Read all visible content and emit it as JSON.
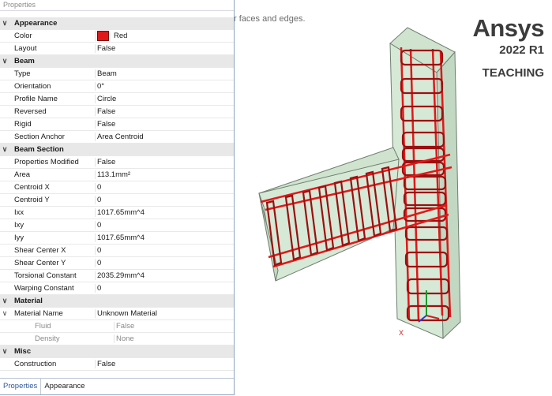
{
  "panel": {
    "title": "Properties",
    "groups": [
      {
        "name": "Appearance",
        "props": [
          {
            "name": "Color",
            "value": "Red"
          },
          {
            "name": "Layout",
            "value": "False"
          }
        ]
      },
      {
        "name": "Beam",
        "props": [
          {
            "name": "Type",
            "value": "Beam"
          },
          {
            "name": "Orientation",
            "value": "0°"
          },
          {
            "name": "Profile Name",
            "value": "Circle"
          },
          {
            "name": "Reversed",
            "value": "False"
          },
          {
            "name": "Rigid",
            "value": "False"
          },
          {
            "name": "Section Anchor",
            "value": "Area Centroid"
          }
        ]
      },
      {
        "name": "Beam Section",
        "props": [
          {
            "name": "Properties Modified",
            "value": "False"
          },
          {
            "name": "Area",
            "value": "113.1mm²"
          },
          {
            "name": "Centroid X",
            "value": "0"
          },
          {
            "name": "Centroid Y",
            "value": "0"
          },
          {
            "name": "Ixx",
            "value": "1017.65mm^4"
          },
          {
            "name": "Ixy",
            "value": "0"
          },
          {
            "name": "Iyy",
            "value": "1017.65mm^4"
          },
          {
            "name": "Shear Center X",
            "value": "0"
          },
          {
            "name": "Shear Center Y",
            "value": "0"
          },
          {
            "name": "Torsional Constant",
            "value": "2035.29mm^4"
          },
          {
            "name": "Warping Constant",
            "value": "0"
          }
        ]
      },
      {
        "name": "Material",
        "props": [
          {
            "name": "Material Name",
            "value": "Unknown Material",
            "expandable": true
          },
          {
            "name": "Fluid",
            "value": "False",
            "sub": true
          },
          {
            "name": "Density",
            "value": "None",
            "sub": true
          }
        ]
      },
      {
        "name": "Misc",
        "props": [
          {
            "name": "Construction",
            "value": "False"
          }
        ]
      }
    ],
    "tabs": [
      "Properties",
      "Appearance"
    ]
  },
  "viewport": {
    "hint": "r faces and edges.",
    "brand": "Ansys",
    "version": "2022 R1",
    "edition": "TEACHING",
    "axis_x_label": "X"
  },
  "colors": {
    "accent": "#e01818",
    "concrete": "#d4e6d4",
    "panel_group": "#e8e8e8"
  }
}
